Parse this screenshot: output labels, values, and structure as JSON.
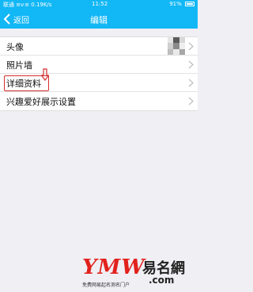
{
  "status_bar": {
    "left": "联通 ≡ν ≡ 0.19K/s",
    "time": "11:52",
    "battery": "91%"
  },
  "nav": {
    "back_label": "返回",
    "title": "编辑"
  },
  "menu": [
    {
      "label": "头像"
    },
    {
      "label": "照片墙"
    },
    {
      "label": "详细资料"
    },
    {
      "label": "兴趣爱好展示设置"
    }
  ],
  "watermark": {
    "logo": "YMW",
    "name": "易名網",
    "domain": ".com",
    "tagline": "免费网易起名测名门户"
  },
  "colors": {
    "header": "#12b7f5",
    "highlight": "#d32f2f"
  }
}
